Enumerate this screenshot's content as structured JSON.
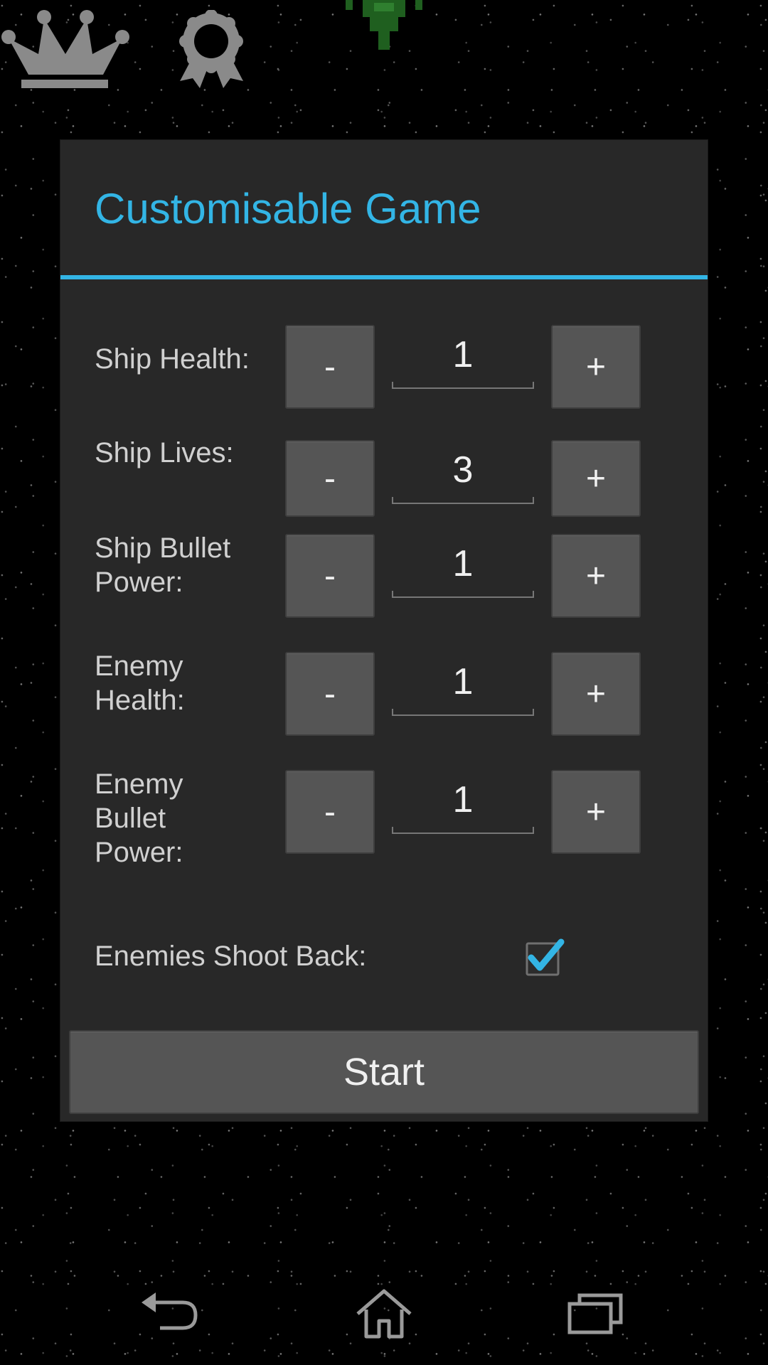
{
  "dialog": {
    "title": "Customisable Game",
    "minus_label": "-",
    "plus_label": "+",
    "stats": [
      {
        "label": "Ship Health:",
        "value": "1"
      },
      {
        "label": "Ship Lives:",
        "value": "3"
      },
      {
        "label": "Ship Bullet Power:",
        "value": "1"
      },
      {
        "label": "Enemy Health:",
        "value": "1"
      },
      {
        "label": "Enemy Bullet Power:",
        "value": "1"
      }
    ],
    "enemies_shoot_back": {
      "label": "Enemies Shoot Back:",
      "checked": true
    },
    "start_label": "Start"
  },
  "icons": [
    "crown-icon",
    "award-badge-icon",
    "ship-sprite",
    "back-icon",
    "home-icon",
    "recent-apps-icon"
  ],
  "colors": {
    "accent": "#33b5e5",
    "dialog_bg": "#282828",
    "button_bg": "#555555",
    "text": "#d0d0d0"
  }
}
